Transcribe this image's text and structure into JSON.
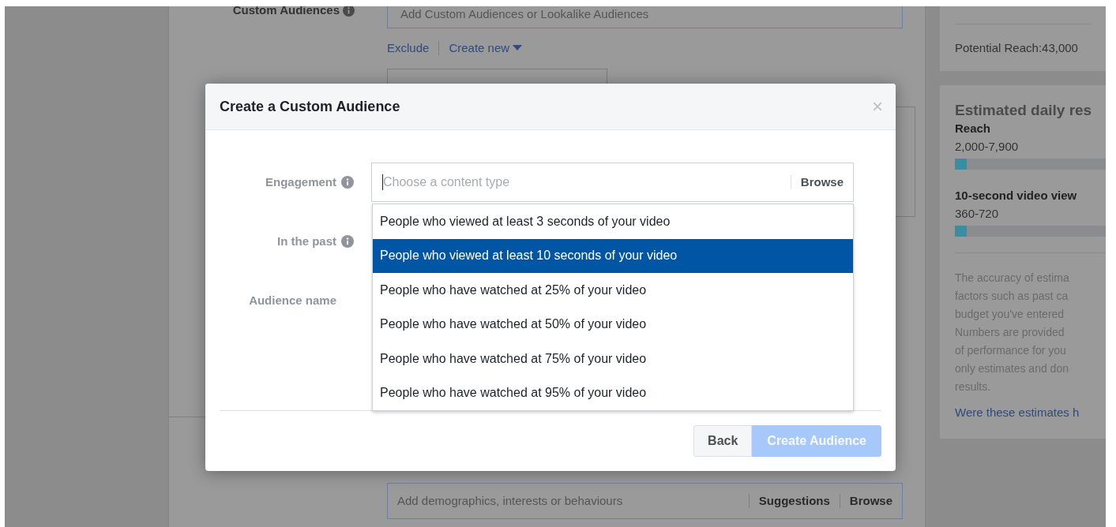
{
  "background_page": {
    "custom_audiences": {
      "label": "Custom Audiences",
      "placeholder": "Add Custom Audiences or Lookalike Audiences"
    },
    "links": [
      "Exclude",
      "Create new"
    ],
    "detailed_targeting": {
      "placeholder": "Add demographics, interests or behaviours",
      "actions": [
        "Suggestions",
        "Browse"
      ]
    }
  },
  "sidebar": {
    "potential_reach": "Potential Reach:43,000",
    "estimates": {
      "title": "Estimated daily res",
      "metrics": [
        {
          "label": "Reach",
          "value": "2,000-7,900",
          "level": 0.08
        },
        {
          "label": "10-second video view",
          "value": "360-720",
          "level": 0.08
        }
      ],
      "description_lines": [
        "The accuracy of estima",
        "factors such as past ca",
        "budget you've entered",
        "Numbers are provided",
        "of performance for you",
        "only estimates and don",
        "results."
      ],
      "feedback_link": "Were these estimates h"
    }
  },
  "dialog": {
    "title": "Create a Custom Audience",
    "close": "×",
    "fields": [
      {
        "label": "Engagement",
        "info": true
      },
      {
        "label": "In the past",
        "info": true
      },
      {
        "label": "Audience name",
        "info": false
      }
    ],
    "content_type": {
      "placeholder": "Choose a content type",
      "browse": "Browse"
    },
    "options": [
      {
        "label": "People who viewed at least 3 seconds of your video",
        "selected": false
      },
      {
        "label": "People who viewed at least 10 seconds of your video",
        "selected": true
      },
      {
        "label": "People who have watched at 25% of your video",
        "selected": false
      },
      {
        "label": "People who have watched at 50% of your video",
        "selected": false
      },
      {
        "label": "People who have watched at 75% of your video",
        "selected": false
      },
      {
        "label": "People who have watched at 95% of your video",
        "selected": false
      }
    ],
    "buttons": [
      {
        "label": "Back"
      },
      {
        "label": "Create Audience",
        "disabled": true
      }
    ]
  }
}
